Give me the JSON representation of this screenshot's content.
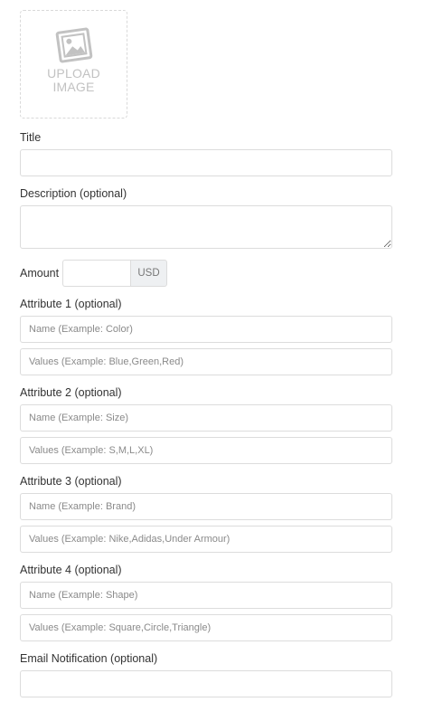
{
  "upload": {
    "label": "UPLOAD IMAGE",
    "line1": "UPLOAD",
    "line2": "IMAGE",
    "icon": "image-icon"
  },
  "title": {
    "label": "Title",
    "value": ""
  },
  "description": {
    "label": "Description (optional)",
    "value": ""
  },
  "amount": {
    "label": "Amount",
    "value": "",
    "currency": "USD"
  },
  "attributes": [
    {
      "label": "Attribute 1 (optional)",
      "name_placeholder": "Name (Example: Color)",
      "values_placeholder": "Values (Example: Blue,Green,Red)"
    },
    {
      "label": "Attribute 2 (optional)",
      "name_placeholder": "Name (Example: Size)",
      "values_placeholder": "Values (Example: S,M,L,XL)"
    },
    {
      "label": "Attribute 3 (optional)",
      "name_placeholder": "Name (Example: Brand)",
      "values_placeholder": "Values (Example: Nike,Adidas,Under Armour)"
    },
    {
      "label": "Attribute 4 (optional)",
      "name_placeholder": "Name (Example: Shape)",
      "values_placeholder": "Values (Example: Square,Circle,Triangle)"
    }
  ],
  "email": {
    "label": "Email Notification (optional)",
    "value": ""
  }
}
